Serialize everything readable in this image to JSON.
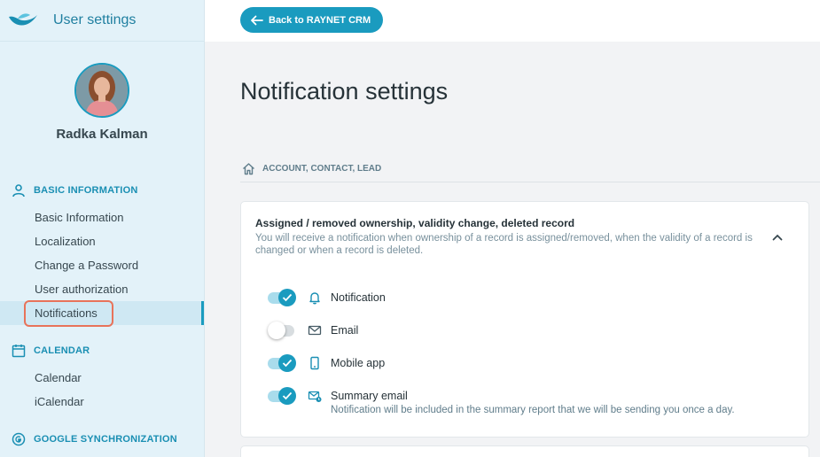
{
  "app": {
    "title": "User settings"
  },
  "user": {
    "name": "Radka Kalman"
  },
  "sidebar": {
    "sections": [
      {
        "title": "BASIC INFORMATION",
        "icon": "person-icon",
        "items": [
          {
            "label": "Basic Information"
          },
          {
            "label": "Localization"
          },
          {
            "label": "Change a Password"
          },
          {
            "label": "User authorization"
          },
          {
            "label": "Notifications",
            "active": true
          }
        ]
      },
      {
        "title": "CALENDAR",
        "icon": "calendar-icon",
        "items": [
          {
            "label": "Calendar"
          },
          {
            "label": "iCalendar"
          }
        ]
      },
      {
        "title": "GOOGLE SYNCHRONIZATION",
        "icon": "google-icon",
        "items": []
      }
    ]
  },
  "topbar": {
    "back_label": "Back to RAYNET CRM"
  },
  "main": {
    "title": "Notification settings",
    "breadcrumb": "ACCOUNT, CONTACT, LEAD",
    "card": {
      "title": "Assigned / removed ownership, validity change, deleted record",
      "description": "You will receive a notification when ownership of a record is assigned/removed, when the validity of a record is changed or when a record is deleted.",
      "options": [
        {
          "label": "Notification",
          "icon": "bell-icon",
          "enabled": true
        },
        {
          "label": "Email",
          "icon": "envelope-icon",
          "enabled": false
        },
        {
          "label": "Mobile app",
          "icon": "mobile-icon",
          "enabled": true
        },
        {
          "label": "Summary email",
          "icon": "summary-email-icon",
          "enabled": true,
          "note": "Notification will be included in the summary report that we will be sending you once a day."
        }
      ]
    }
  },
  "colors": {
    "accent": "#1a9bbf",
    "sidebar_bg": "#e3f2f9",
    "highlight": "#e8735a"
  }
}
